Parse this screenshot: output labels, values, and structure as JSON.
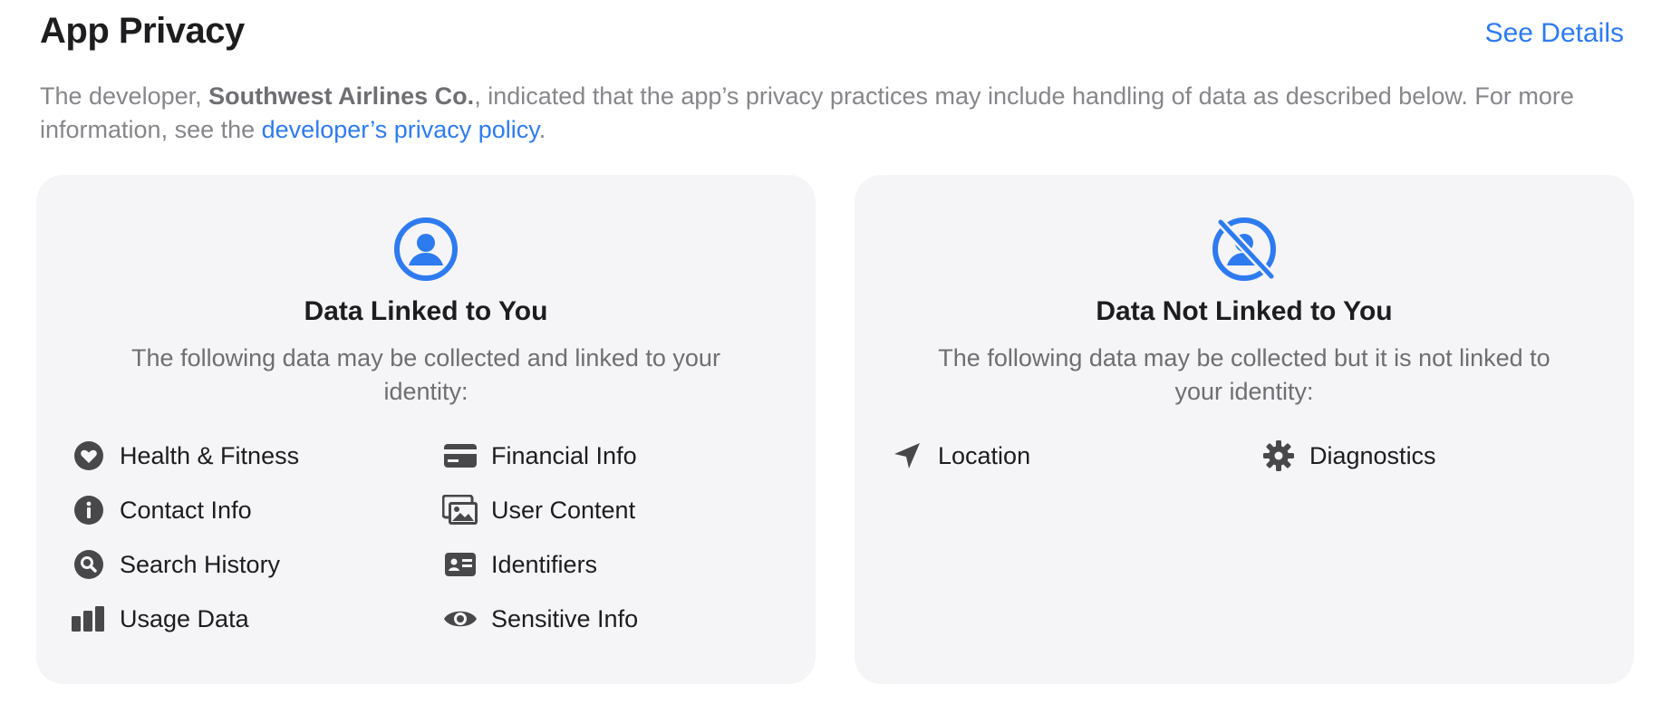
{
  "header": {
    "title": "App Privacy",
    "see_details": "See Details"
  },
  "description": {
    "prefix": "The developer, ",
    "developer": "Southwest Airlines Co.",
    "middle": ", indicated that the app’s privacy practices may include handling of data as described below. For more information, see the ",
    "policy_link": "developer’s privacy policy",
    "suffix": "."
  },
  "colors": {
    "accent": "#2e7bf0",
    "card_bg": "#f5f5f7",
    "icon": "#48484a"
  },
  "linked": {
    "icon": "person-circle-icon",
    "title": "Data Linked to You",
    "subtitle": "The following data may be collected and linked to your identity:",
    "items": [
      {
        "label": "Health & Fitness",
        "icon": "heart-icon"
      },
      {
        "label": "Financial Info",
        "icon": "credit-card-icon"
      },
      {
        "label": "Contact Info",
        "icon": "info-icon"
      },
      {
        "label": "User Content",
        "icon": "photos-icon"
      },
      {
        "label": "Search History",
        "icon": "magnifier-icon"
      },
      {
        "label": "Identifiers",
        "icon": "id-card-icon"
      },
      {
        "label": "Usage Data",
        "icon": "bar-chart-icon"
      },
      {
        "label": "Sensitive Info",
        "icon": "eye-icon"
      }
    ]
  },
  "not_linked": {
    "icon": "person-circle-slash-icon",
    "title": "Data Not Linked to You",
    "subtitle": "The following data may be collected but it is not linked to your identity:",
    "items": [
      {
        "label": "Location",
        "icon": "location-arrow-icon"
      },
      {
        "label": "Diagnostics",
        "icon": "gear-icon"
      }
    ]
  }
}
